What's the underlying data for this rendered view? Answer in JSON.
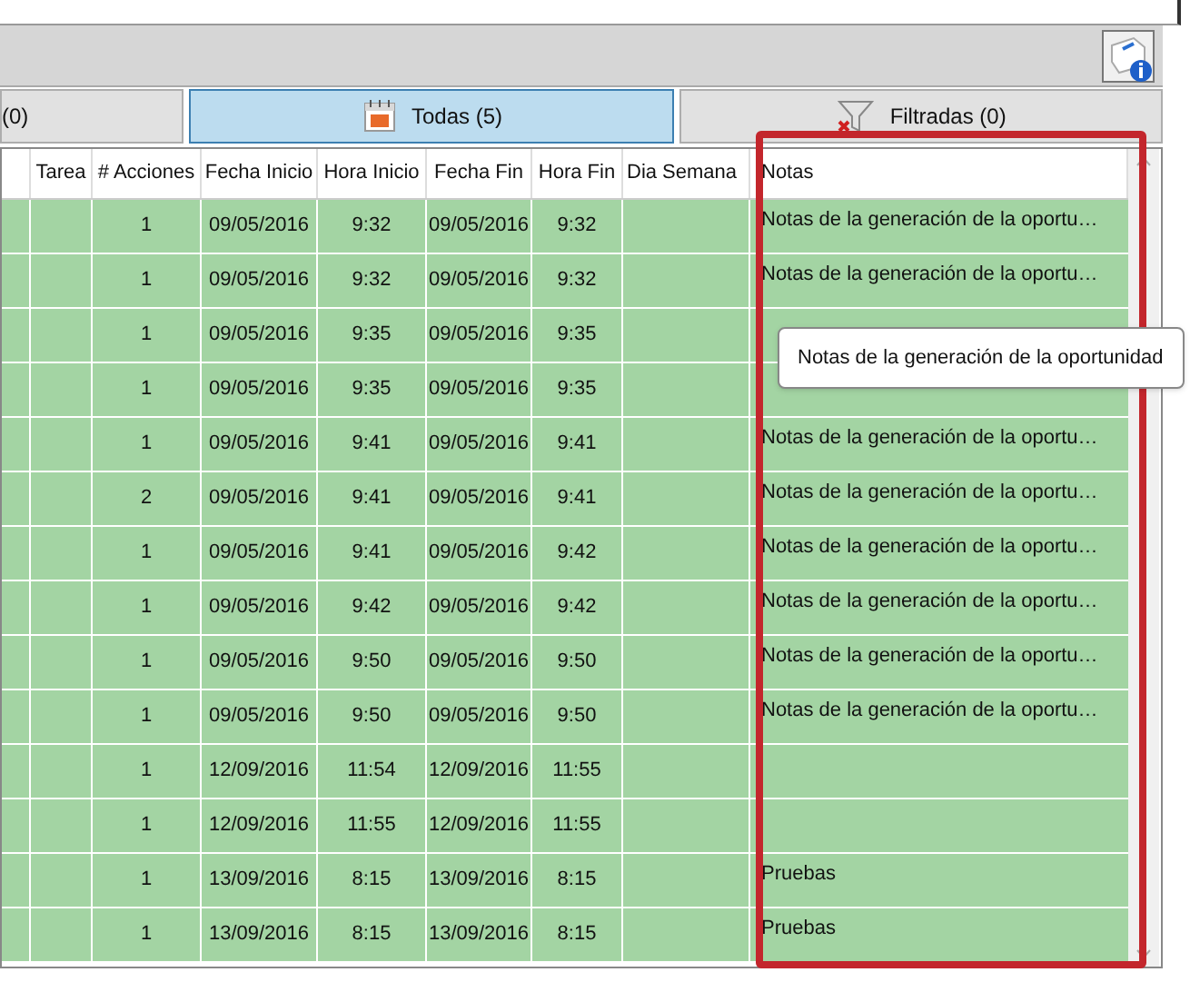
{
  "tabs": [
    {
      "label": "(0)",
      "selected": false,
      "kind": "plain"
    },
    {
      "label": "Todas (5)",
      "selected": true,
      "kind": "calendar"
    },
    {
      "label": "Filtradas (0)",
      "selected": false,
      "kind": "filter"
    }
  ],
  "table": {
    "columns": [
      "Tarea",
      "# Acciones",
      "Fecha Inicio",
      "Hora Inicio",
      "Fecha Fin",
      "Hora Fin",
      "Dia Semana",
      "Notas"
    ],
    "rows": [
      {
        "acciones": "1",
        "fecha_inicio": "09/05/2016",
        "hora_inicio": "9:32",
        "fecha_fin": "09/05/2016",
        "hora_fin": "9:32",
        "notas": "Notas de la generación de la oportu…"
      },
      {
        "acciones": "1",
        "fecha_inicio": "09/05/2016",
        "hora_inicio": "9:32",
        "fecha_fin": "09/05/2016",
        "hora_fin": "9:32",
        "notas": "Notas de la generación de la oportu…"
      },
      {
        "acciones": "1",
        "fecha_inicio": "09/05/2016",
        "hora_inicio": "9:35",
        "fecha_fin": "09/05/2016",
        "hora_fin": "9:35"
      },
      {
        "acciones": "1",
        "fecha_inicio": "09/05/2016",
        "hora_inicio": "9:35",
        "fecha_fin": "09/05/2016",
        "hora_fin": "9:35"
      },
      {
        "acciones": "1",
        "fecha_inicio": "09/05/2016",
        "hora_inicio": "9:41",
        "fecha_fin": "09/05/2016",
        "hora_fin": "9:41",
        "notas": "Notas de la generación de la oportu…"
      },
      {
        "acciones": "2",
        "fecha_inicio": "09/05/2016",
        "hora_inicio": "9:41",
        "fecha_fin": "09/05/2016",
        "hora_fin": "9:41",
        "notas": "Notas de la generación de la oportu…"
      },
      {
        "acciones": "1",
        "fecha_inicio": "09/05/2016",
        "hora_inicio": "9:41",
        "fecha_fin": "09/05/2016",
        "hora_fin": "9:42",
        "notas": "Notas de la generación de la oportu…"
      },
      {
        "acciones": "1",
        "fecha_inicio": "09/05/2016",
        "hora_inicio": "9:42",
        "fecha_fin": "09/05/2016",
        "hora_fin": "9:42",
        "notas": "Notas de la generación de la oportu…"
      },
      {
        "acciones": "1",
        "fecha_inicio": "09/05/2016",
        "hora_inicio": "9:50",
        "fecha_fin": "09/05/2016",
        "hora_fin": "9:50",
        "notas": "Notas de la generación de la oportu…"
      },
      {
        "acciones": "1",
        "fecha_inicio": "09/05/2016",
        "hora_inicio": "9:50",
        "fecha_fin": "09/05/2016",
        "hora_fin": "9:50",
        "notas": "Notas de la generación de la oportu…"
      },
      {
        "acciones": "1",
        "fecha_inicio": "12/09/2016",
        "hora_inicio": "11:54",
        "fecha_fin": "12/09/2016",
        "hora_fin": "11:55"
      },
      {
        "acciones": "1",
        "fecha_inicio": "12/09/2016",
        "hora_inicio": "11:55",
        "fecha_fin": "12/09/2016",
        "hora_fin": "11:55"
      },
      {
        "acciones": "1",
        "fecha_inicio": "13/09/2016",
        "hora_inicio": "8:15",
        "fecha_fin": "13/09/2016",
        "hora_fin": "8:15",
        "notas": "Pruebas"
      },
      {
        "acciones": "1",
        "fecha_inicio": "13/09/2016",
        "hora_inicio": "8:15",
        "fecha_fin": "13/09/2016",
        "hora_fin": "8:15",
        "notas": "Pruebas"
      }
    ]
  },
  "tooltip": "Notas de la generación de la oportunidad"
}
